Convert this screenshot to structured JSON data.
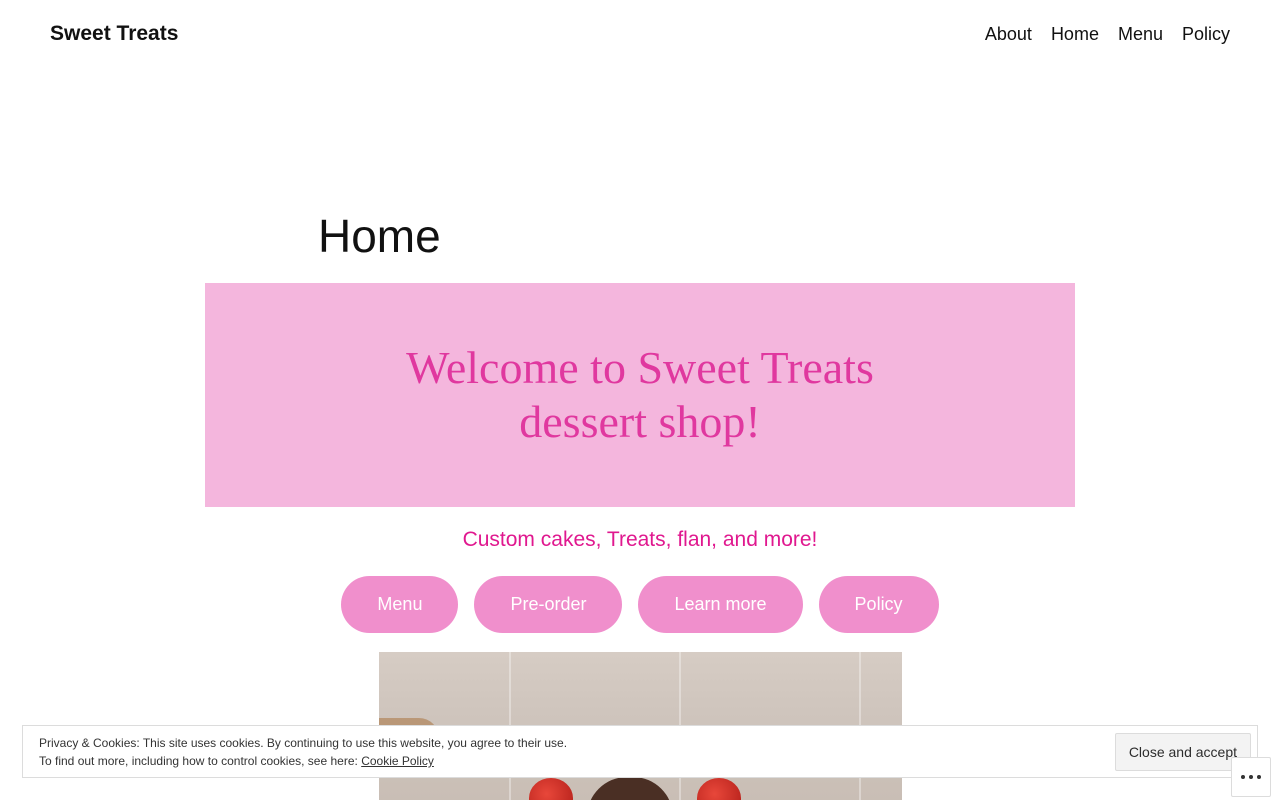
{
  "header": {
    "site_title": "Sweet Treats",
    "nav": [
      "About",
      "Home",
      "Menu",
      "Policy"
    ]
  },
  "page": {
    "title": "Home"
  },
  "hero": {
    "heading": "Welcome to Sweet Treats dessert shop!",
    "background_color": "#f4b6dd",
    "text_color": "#e0389f"
  },
  "tagline": "Custom cakes, Treats, flan, and more!",
  "buttons": [
    "Menu",
    "Pre-order",
    "Learn more",
    "Policy"
  ],
  "cookie_banner": {
    "line1": "Privacy & Cookies: This site uses cookies. By continuing to use this website, you agree to their use.",
    "line2_prefix": "To find out more, including how to control cookies, see here: ",
    "link_label": "Cookie Policy",
    "accept_label": "Close and accept"
  },
  "icons": {
    "more": "ellipsis-icon"
  },
  "colors": {
    "button": "#f08fcc",
    "tagline": "#e0188f"
  }
}
